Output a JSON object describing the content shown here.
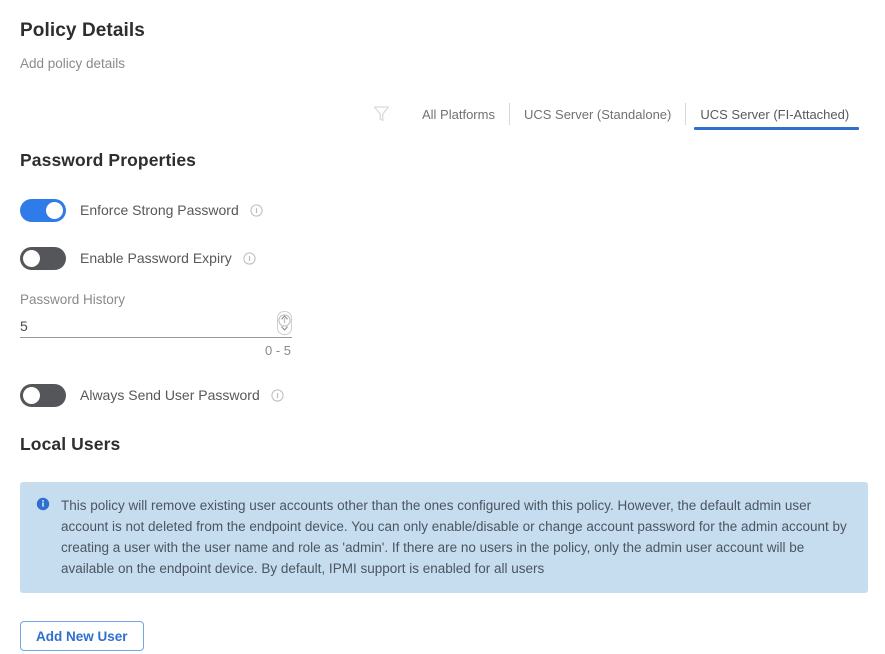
{
  "header": {
    "title": "Policy Details",
    "subtitle": "Add policy details"
  },
  "platform_filter": {
    "filter_icon": "filter-funnel-icon",
    "tabs": [
      {
        "label": "All Platforms",
        "active": false
      },
      {
        "label": "UCS Server (Standalone)",
        "active": false
      },
      {
        "label": "UCS Server (FI-Attached)",
        "active": true
      }
    ],
    "active_underline_color": "#2f6fd0"
  },
  "password_properties": {
    "heading": "Password Properties",
    "toggles": [
      {
        "label": "Enforce Strong Password",
        "state": "on",
        "info_icon": "info-circle-icon"
      },
      {
        "label": "Enable Password Expiry",
        "state": "off",
        "info_icon": "info-circle-icon"
      }
    ],
    "password_history": {
      "label": "Password History",
      "value": "5",
      "hint": "0 - 5",
      "spinner_icon": "spinner-up-down-icon",
      "info_icon": "info-circle-icon"
    },
    "always_send_user_password": {
      "label": "Always Send User Password",
      "state": "off",
      "info_icon": "info-circle-icon"
    }
  },
  "local_users": {
    "heading": "Local Users",
    "banner": {
      "icon": "info-circle-filled-icon",
      "text": "This policy will remove existing user accounts other than the ones configured with this policy. However, the default admin user account is not deleted from the endpoint device. You can only enable/disable or change account password for the admin account by creating a user with the user name and role as 'admin'. If there are no users in the policy, only the admin user account will be available on the endpoint device. By default, IPMI support is enabled for all users",
      "background_color": "#c6ddf0"
    },
    "add_new_user_button": "Add New User"
  },
  "colors": {
    "accent_blue": "#2f6fd0",
    "toggle_on": "#2f7bea",
    "toggle_off": "#545659",
    "banner_bg": "#c6ddf0"
  }
}
